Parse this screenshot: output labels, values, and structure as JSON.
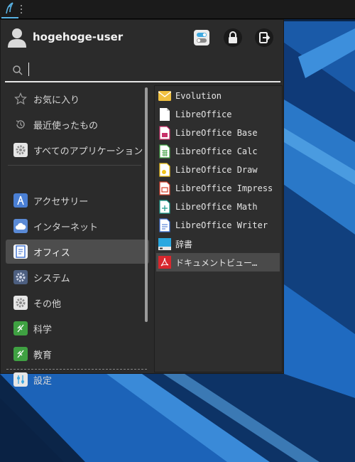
{
  "user": {
    "name": "hogehoge-user"
  },
  "search": {
    "placeholder": "",
    "value": ""
  },
  "actions": [
    {
      "name": "settings-toggle-icon",
      "color": "#3fa9e0"
    },
    {
      "name": "lock-icon"
    },
    {
      "name": "logout-icon"
    }
  ],
  "categories": [
    {
      "label": "お気に入り",
      "icon": "star-icon"
    },
    {
      "label": "最近使ったもの",
      "icon": "history-icon"
    },
    {
      "label": "すべてのアプリケーション",
      "icon": "gear-icon"
    },
    {
      "label": "アクセサリー",
      "icon": "accessories-icon"
    },
    {
      "label": "インターネット",
      "icon": "cloud-icon"
    },
    {
      "label": "オフィス",
      "icon": "office-document-icon",
      "selected": true
    },
    {
      "label": "システム",
      "icon": "system-gear-icon"
    },
    {
      "label": "その他",
      "icon": "other-gear-icon"
    },
    {
      "label": "科学",
      "icon": "science-icon"
    },
    {
      "label": "教育",
      "icon": "education-icon"
    },
    {
      "label": "設定",
      "icon": "settings-icon"
    }
  ],
  "apps": [
    {
      "label": "Evolution",
      "icon": "evolution-mail-icon",
      "color": "#f0c040"
    },
    {
      "label": "LibreOffice",
      "icon": "libreoffice-icon",
      "color": "#ffffff"
    },
    {
      "label": "LibreOffice Base",
      "icon": "libreoffice-base-icon",
      "color": "#c9306a"
    },
    {
      "label": "LibreOffice Calc",
      "icon": "libreoffice-calc-icon",
      "color": "#3fa142"
    },
    {
      "label": "LibreOffice Draw",
      "icon": "libreoffice-draw-icon",
      "color": "#f2c318"
    },
    {
      "label": "LibreOffice Impress",
      "icon": "libreoffice-impress-icon",
      "color": "#d7402b"
    },
    {
      "label": "LibreOffice Math",
      "icon": "libreoffice-math-icon",
      "color": "#1a9b8c"
    },
    {
      "label": "LibreOffice Writer",
      "icon": "libreoffice-writer-icon",
      "color": "#3b6fd0"
    },
    {
      "label": "辞書",
      "icon": "dictionary-icon",
      "color": "#29a8e0"
    },
    {
      "label": "ドキュメントビュー…",
      "icon": "pdf-viewer-icon",
      "color": "#d8272d",
      "hover": true
    }
  ]
}
